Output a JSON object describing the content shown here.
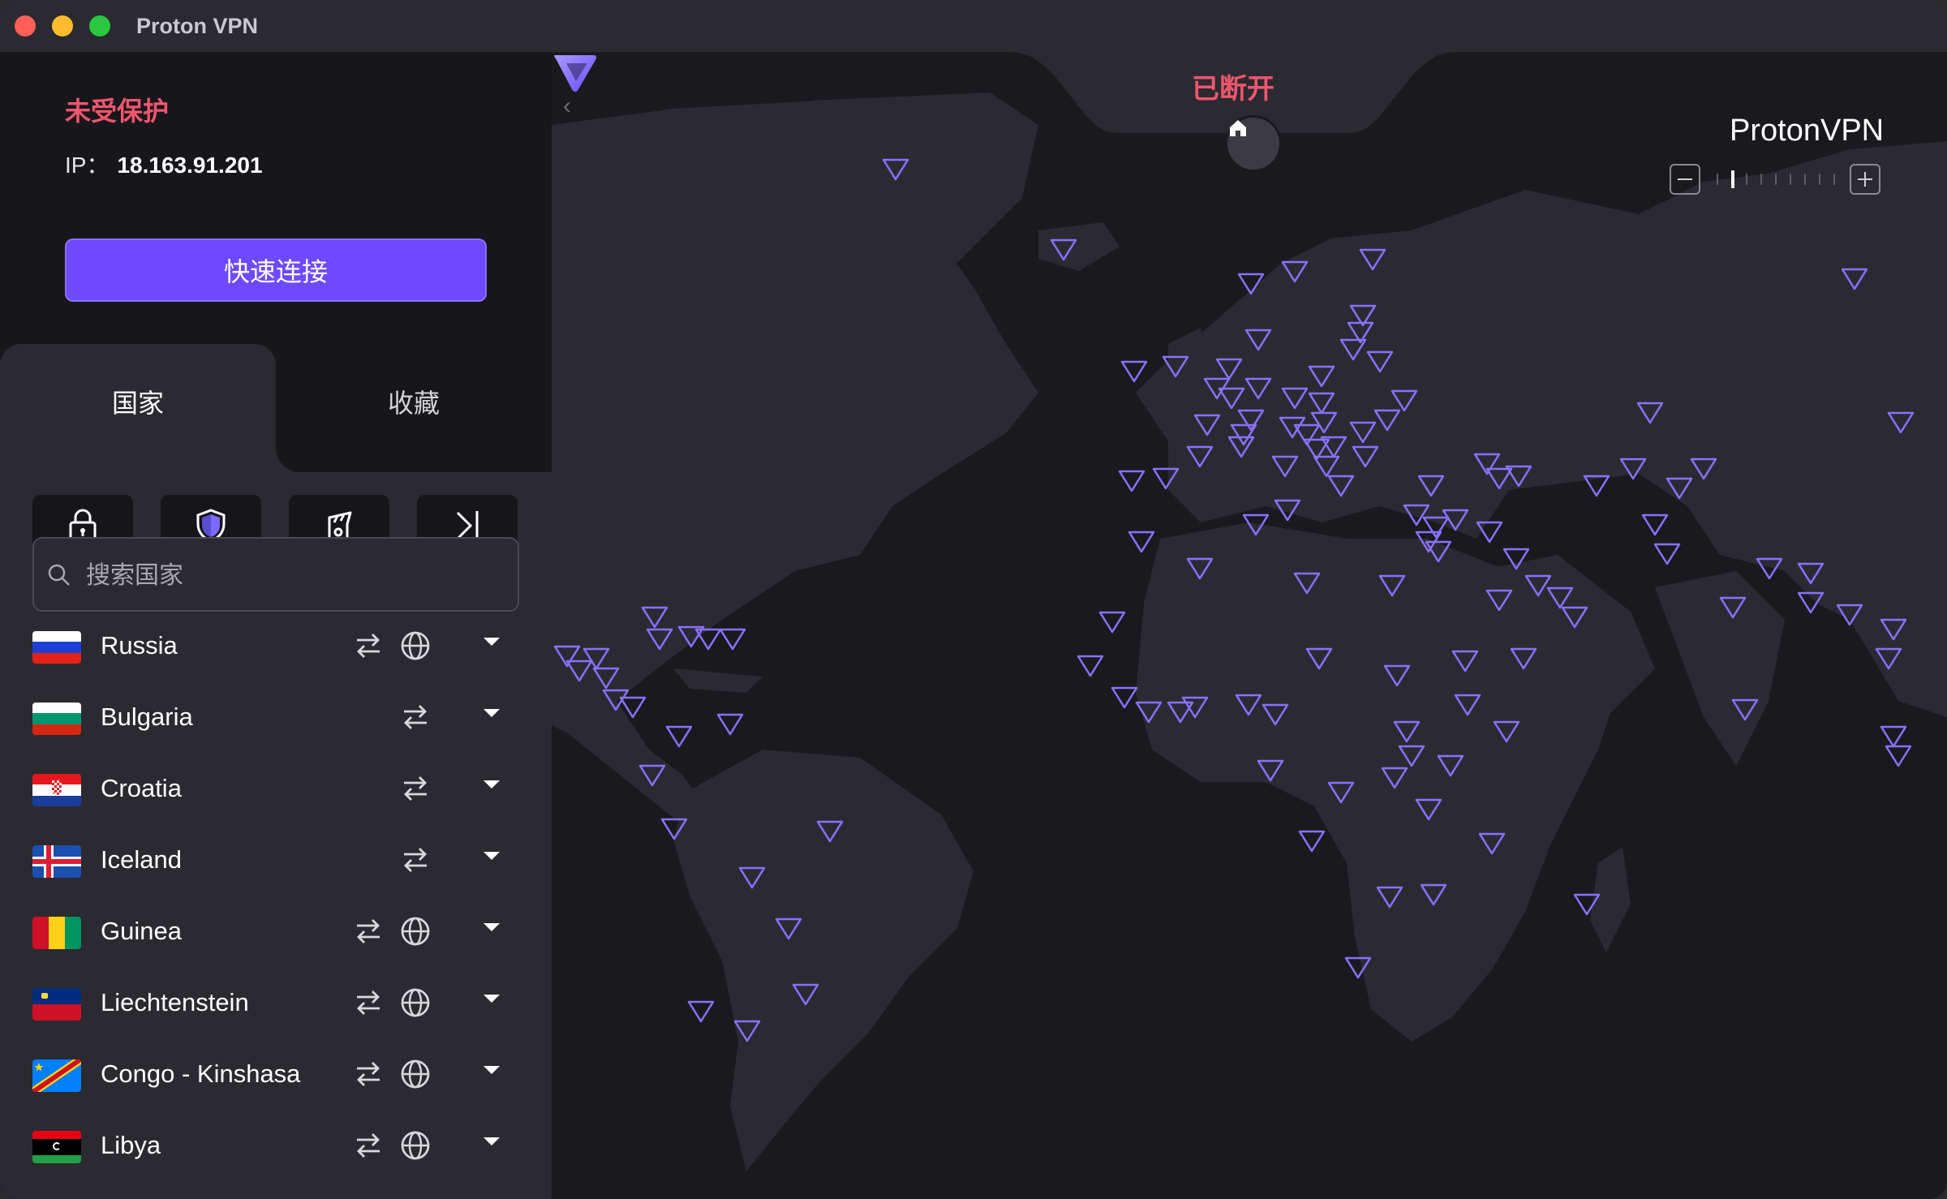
{
  "window": {
    "title": "Proton VPN"
  },
  "status": {
    "protection": "未受保护",
    "ip_label": "IP：",
    "ip_value": "18.163.91.201",
    "quick_connect": "快速连接"
  },
  "tabs": {
    "countries": "国家",
    "favorites": "收藏"
  },
  "search": {
    "placeholder": "搜索国家"
  },
  "countries": [
    {
      "name": "Russia",
      "features": [
        "p2p",
        "tor"
      ]
    },
    {
      "name": "Bulgaria",
      "features": [
        "p2p"
      ]
    },
    {
      "name": "Croatia",
      "features": [
        "p2p"
      ]
    },
    {
      "name": "Iceland",
      "features": [
        "p2p"
      ]
    },
    {
      "name": "Guinea",
      "features": [
        "p2p",
        "tor"
      ]
    },
    {
      "name": "Liechtenstein",
      "features": [
        "p2p",
        "tor"
      ]
    },
    {
      "name": "Congo - Kinshasa",
      "features": [
        "p2p",
        "tor"
      ]
    },
    {
      "name": "Libya",
      "features": [
        "p2p",
        "tor"
      ]
    }
  ],
  "map": {
    "connection_status": "已断开",
    "brand": "Proton",
    "brand_suffix": "VPN",
    "zoom_level": 1,
    "zoom_steps": 9
  },
  "colors": {
    "accent": "#6d4aff",
    "danger": "#f0566e",
    "marker": "#8a70ff"
  },
  "icons": {
    "secure_core": "lock-icon",
    "netshield": "shield-icon",
    "p2p": "p2p-icon",
    "tor": "globe-icon",
    "streaming": "streaming-icon",
    "home": "home-icon"
  }
}
